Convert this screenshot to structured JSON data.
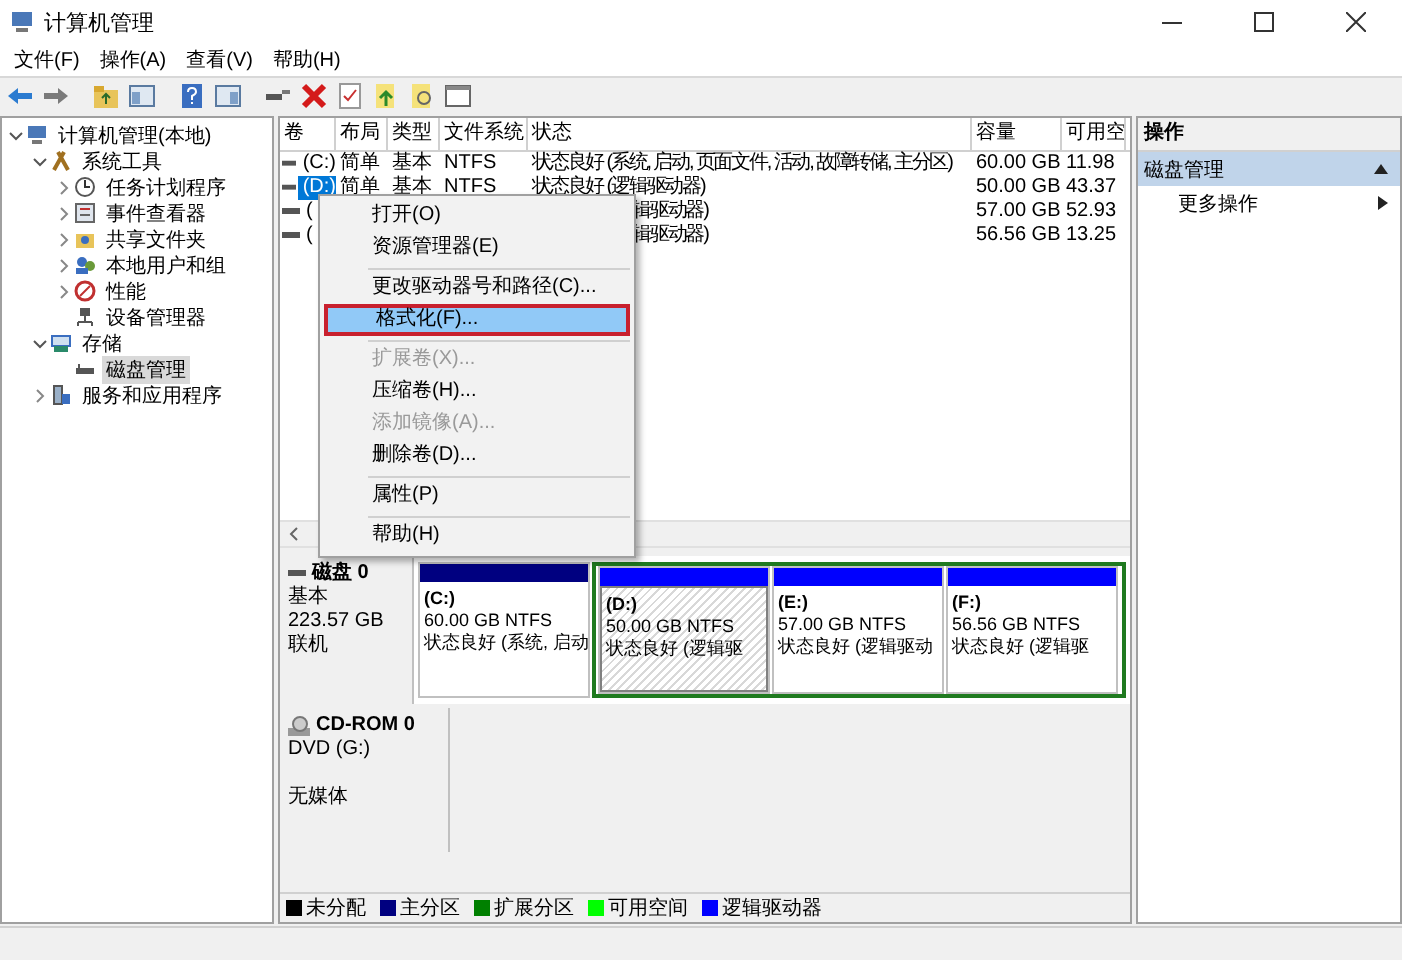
{
  "window": {
    "title": "计算机管理"
  },
  "menu_bar": [
    "文件(F)",
    "操作(A)",
    "查看(V)",
    "帮助(H)"
  ],
  "tree": [
    {
      "label": "计算机管理(本地)",
      "selected": false,
      "expanded": true,
      "children": [
        {
          "label": "系统工具",
          "selected": false,
          "expanded": true,
          "children": [
            {
              "label": "任务计划程序",
              "selected": false,
              "expanded": false
            },
            {
              "label": "事件查看器",
              "selected": false,
              "expanded": false
            },
            {
              "label": "共享文件夹",
              "selected": false,
              "expanded": false
            },
            {
              "label": "本地用户和组",
              "selected": false,
              "expanded": false
            },
            {
              "label": "性能",
              "selected": false,
              "expanded": false
            },
            {
              "label": "设备管理器",
              "selected": false
            }
          ]
        },
        {
          "label": "存储",
          "selected": false,
          "expanded": true,
          "children": [
            {
              "label": "磁盘管理",
              "selected": true
            }
          ]
        },
        {
          "label": "服务和应用程序",
          "selected": false,
          "expanded": false
        }
      ]
    }
  ],
  "volumes": {
    "columns": [
      "卷",
      "布局",
      "类型",
      "文件系统",
      "状态",
      "容量",
      "可用空"
    ],
    "rows": [
      {
        "kind": "full",
        "selected": false,
        "cells": [
          "(C:)",
          "简单",
          "基本",
          "NTFS",
          "状态良好 (系统, 启动, 页面文件, 活动, 故障转储, 主分区)",
          "60.00 GB",
          "11.98"
        ]
      },
      {
        "kind": "full",
        "selected": true,
        "cells": [
          "(D:)",
          "简单",
          "基本",
          "NTFS",
          "状态良好 (逻辑驱动器)",
          "50.00 GB",
          "43.37"
        ]
      },
      {
        "kind": "covered",
        "selected": false,
        "cells": [
          "(",
          "",
          "",
          "",
          "辑驱动器)",
          "57.00 GB",
          "52.93"
        ]
      },
      {
        "kind": "covered",
        "selected": false,
        "cells": [
          "(",
          "",
          "",
          "",
          "辑驱动器)",
          "56.56 GB",
          "13.25"
        ]
      }
    ]
  },
  "context_menu": [
    {
      "kind": "item",
      "label": "打开(O)",
      "disabled": false,
      "selected": false,
      "outlined": false
    },
    {
      "kind": "item",
      "label": "资源管理器(E)",
      "disabled": false,
      "selected": false,
      "outlined": false
    },
    {
      "kind": "separator"
    },
    {
      "kind": "item",
      "label": "更改驱动器号和路径(C)...",
      "disabled": false,
      "selected": false,
      "outlined": false
    },
    {
      "kind": "item",
      "label": "格式化(F)...",
      "disabled": false,
      "selected": true,
      "outlined": true
    },
    {
      "kind": "separator"
    },
    {
      "kind": "item",
      "label": "扩展卷(X)...",
      "disabled": true,
      "selected": false,
      "outlined": false
    },
    {
      "kind": "item",
      "label": "压缩卷(H)...",
      "disabled": false,
      "selected": false,
      "outlined": false
    },
    {
      "kind": "item",
      "label": "添加镜像(A)...",
      "disabled": true,
      "selected": false,
      "outlined": false
    },
    {
      "kind": "item",
      "label": "删除卷(D)...",
      "disabled": false,
      "selected": false,
      "outlined": false
    },
    {
      "kind": "separator"
    },
    {
      "kind": "item",
      "label": "属性(P)",
      "disabled": false,
      "selected": false,
      "outlined": false
    },
    {
      "kind": "separator"
    },
    {
      "kind": "item",
      "label": "帮助(H)",
      "disabled": false,
      "selected": false,
      "outlined": false
    }
  ],
  "disks": [
    {
      "kind": "disk",
      "name": "磁盘 0",
      "type": "基本",
      "size": "223.57 GB",
      "status": "联机",
      "partitions": [
        {
          "kind": "primary",
          "label": "(C:)",
          "size": "60.00 GB NTFS",
          "status": "状态良好 (系统, 启动",
          "selected": false
        },
        {
          "kind": "logical",
          "label": "(D:)",
          "size": "50.00 GB NTFS",
          "status": "状态良好 (逻辑驱",
          "selected": true
        },
        {
          "kind": "logical",
          "label": "(E:)",
          "size": "57.00 GB NTFS",
          "status": "状态良好 (逻辑驱动",
          "selected": false
        },
        {
          "kind": "logical",
          "label": "(F:)",
          "size": "56.56 GB NTFS",
          "status": "状态良好 (逻辑驱",
          "selected": false
        }
      ]
    },
    {
      "kind": "cdrom",
      "name": "CD-ROM 0",
      "type": "DVD (G:)",
      "status": "无媒体"
    }
  ],
  "legend": [
    {
      "label": "未分配",
      "color": "#000000"
    },
    {
      "label": "主分区",
      "color": "#000080"
    },
    {
      "label": "扩展分区",
      "color": "#008000"
    },
    {
      "label": "可用空间",
      "color": "#00ff00"
    },
    {
      "label": "逻辑驱动器",
      "color": "#0000ff"
    }
  ],
  "actions": {
    "title": "操作",
    "items": [
      {
        "kind": "section",
        "label": "磁盘管理",
        "selected": true
      },
      {
        "kind": "item",
        "label": "更多操作",
        "selected": false
      }
    ]
  }
}
